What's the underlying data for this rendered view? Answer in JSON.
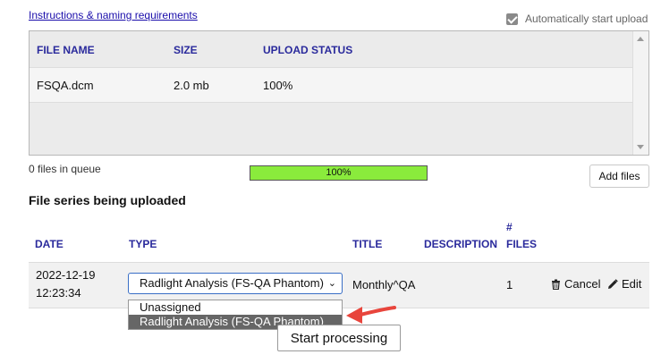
{
  "instructions_link": "Instructions & naming requirements",
  "auto_start": {
    "label": "Automatically start upload",
    "checked": true
  },
  "upload_table": {
    "headers": [
      "FILE NAME",
      "SIZE",
      "UPLOAD STATUS"
    ],
    "rows": [
      {
        "file_name": "FSQA.dcm",
        "size": "2.0 mb",
        "status": "100%"
      }
    ]
  },
  "queue_text": "0 files in queue",
  "progress": {
    "label": "100%",
    "value": 100
  },
  "add_files_label": "Add files",
  "series_section_title": "File series being uploaded",
  "series_table": {
    "headers": {
      "date": "DATE",
      "type": "TYPE",
      "title": "TITLE",
      "description": "DESCRIPTION",
      "files_hash": "#",
      "files": "FILES"
    },
    "row": {
      "date": "2022-12-19",
      "time": "12:23:34",
      "type_selected": "Radlight Analysis (FS-QA Phantom)",
      "title": "Monthly^QA",
      "description": "",
      "files": "1",
      "cancel_label": "Cancel",
      "edit_label": "Edit"
    }
  },
  "type_dropdown": {
    "options": [
      "Unassigned",
      "Radlight Analysis (FS-QA Phantom)"
    ],
    "highlighted_index": 1
  },
  "start_processing_label": "Start processing",
  "colors": {
    "header_text": "#2a2a9c",
    "progress_fill": "#8aeb3c",
    "annotation_arrow": "#e8453c",
    "select_border": "#3a6fc6"
  }
}
